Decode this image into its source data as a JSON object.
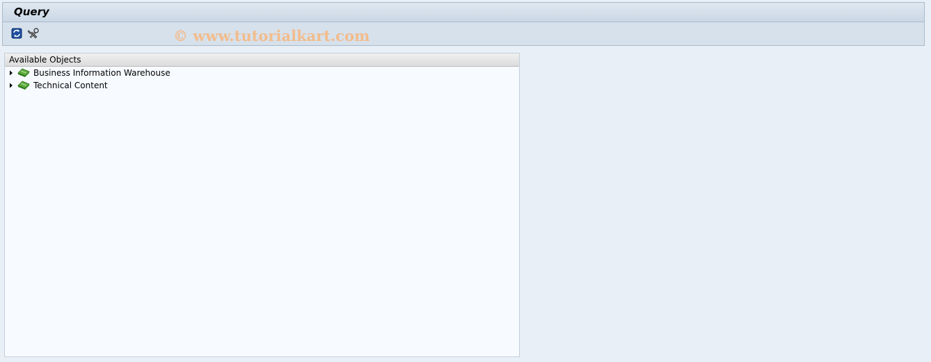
{
  "header": {
    "title": "Query"
  },
  "toolbar": {
    "buttons": [
      {
        "icon": "refresh-icon"
      },
      {
        "icon": "settings-tools-icon"
      }
    ]
  },
  "watermark": {
    "text": "© www.tutorialkart.com"
  },
  "panel": {
    "header": "Available Objects",
    "items": [
      {
        "label": "Business Information Warehouse",
        "icon": "infoarea-icon",
        "expanded": false
      },
      {
        "label": "Technical Content",
        "icon": "infoarea-icon",
        "expanded": false
      }
    ]
  },
  "colors": {
    "background": "#e8eff6",
    "watermark": "#f2bc8c",
    "icon_green": "#3d8a2e"
  }
}
